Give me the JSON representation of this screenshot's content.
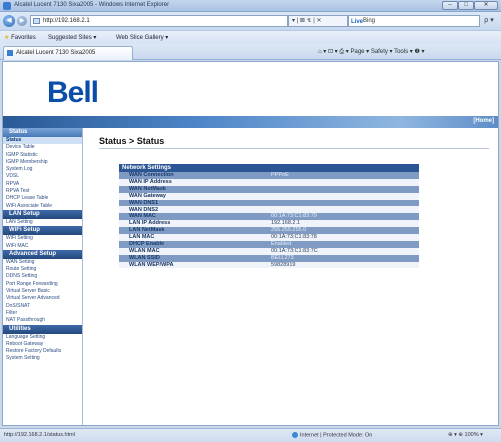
{
  "window": {
    "title": "Alcatel Lucent 7130 Sixa2005 - Windows Internet Explorer",
    "min": "–",
    "max": "□",
    "close": "✕"
  },
  "address": {
    "url": "http://192.168.2.1",
    "actions": "▾ | ⊠ ↯ | ✕",
    "search_engine": "Live",
    "search_text": "Bing",
    "search_btn": "ρ ▾",
    "back": "◀",
    "forward": "▶"
  },
  "favorites": {
    "favorites_label": "Favorites",
    "suggested": "Suggested Sites ▾",
    "web_slice": "Web Slice Gallery ▾"
  },
  "tab": {
    "title": "Alcatel Lucent 7130 Sixa2005",
    "commands": "⌂ ▾ ⊡ ▾ ⎙ ▾ Page ▾  Safety ▾  Tools ▾  ❷ ▾"
  },
  "page": {
    "logo": "Bell",
    "home_link": "[Home]",
    "heading": "Status > Status"
  },
  "sidebar": [
    {
      "section": "Status",
      "first": true,
      "items": [
        "Status",
        "Device Table",
        "IGMP Statistic",
        "IGMP Membership",
        "System Log",
        "VDSL",
        "RPVA",
        "RPVA Test",
        "DHCP Lease Table",
        "WiFi Associate Table"
      ],
      "active": "Status"
    },
    {
      "section": "LAN Setup",
      "items": [
        "LAN Setting"
      ]
    },
    {
      "section": "WiFi Setup",
      "items": [
        "WiFi Setting",
        "WiFi MAC"
      ]
    },
    {
      "section": "Advanced Setup",
      "items": [
        "WAN Setting",
        "Route Setting",
        "DDNS Setting",
        "Port Range Forwarding",
        "Virtual Server Basic",
        "Virtual Server Advanced",
        "DoS/SNAT",
        "Filter",
        "NAT Passthrough"
      ]
    },
    {
      "section": "Utilities",
      "items": [
        "Language Setting",
        "Reboot Gateway",
        "Restore Factory Defaults",
        "System Setting"
      ]
    }
  ],
  "network_settings": {
    "caption": "Network Settings",
    "rows": [
      {
        "label": "WAN Connection",
        "value": "PPPoE"
      },
      {
        "label": "WAN IP Address",
        "value": ""
      },
      {
        "label": "WAN NetMask",
        "value": ""
      },
      {
        "label": "WAN Gateway",
        "value": ""
      },
      {
        "label": "WAN DNS1",
        "value": ""
      },
      {
        "label": "WAN DNS2",
        "value": ""
      },
      {
        "label": "WAN MAC",
        "value": "00:1A:73:C1:83:79"
      },
      {
        "label": "LAN IP Address",
        "value": "192.168.2.1"
      },
      {
        "label": "LAN NetMask",
        "value": "255.255.255.0"
      },
      {
        "label": "LAN MAC",
        "value": "00:1A:73:C1:83:78"
      },
      {
        "label": "DHCP Enable",
        "value": "Enabled"
      },
      {
        "label": "WLAN MAC",
        "value": "00:1A:73:C1:83:7C"
      },
      {
        "label": "WLAN SSID",
        "value": "BELL273"
      },
      {
        "label": "WLAN WEP/WPA",
        "value": "59828919"
      }
    ]
  },
  "statusbar": {
    "url": "http://192.168.2.1/status.html",
    "zone": "Internet | Protected Mode: On",
    "zoom": "⊕ ▾  ⊕ 100% ▾"
  }
}
